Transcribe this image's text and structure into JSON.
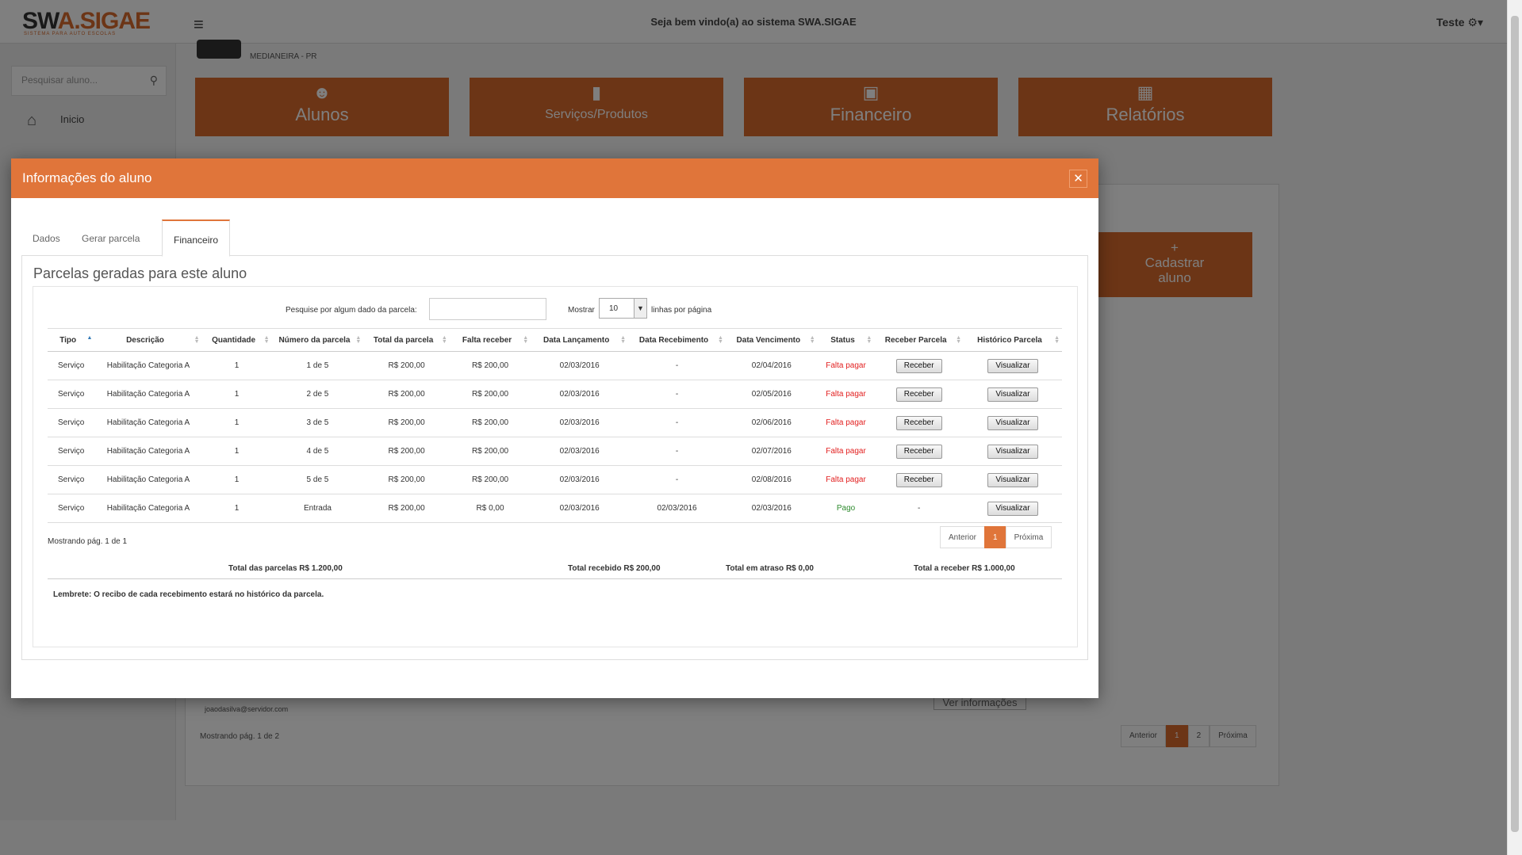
{
  "app": {
    "logo_part1": "SW",
    "logo_part2": "A.SIGAE",
    "logo_tagline": "SISTEMA PARA AUTO ESCOLAS",
    "welcome": "Seja bem vindo(a) ao sistema SWA.SIGAE",
    "user": "Teste",
    "city": "MEDIANEIRA - PR",
    "brand_color": "#d96a2c"
  },
  "sidebar": {
    "search_placeholder": "Pesquisar aluno...",
    "items": [
      {
        "label": "Inicio",
        "icon": "home-icon"
      }
    ]
  },
  "tiles": [
    {
      "label": "Alunos",
      "icon": "users-icon"
    },
    {
      "label": "Serviços/Produtos",
      "icon": "car-icon"
    },
    {
      "label": "Financeiro",
      "icon": "money-icon"
    },
    {
      "label": "Relatórios",
      "icon": "table-icon"
    }
  ],
  "background": {
    "add_student": "Cadastrar aluno",
    "email": "joaodasilva@servidor.com",
    "ver_info": "Ver informações",
    "showing": "Mostrando pág. 1 de 2",
    "pager": [
      "Anterior",
      "1",
      "2",
      "Próxima"
    ]
  },
  "modal": {
    "title": "Informações do aluno",
    "tabs": [
      "Dados",
      "Gerar parcela",
      "Financeiro"
    ],
    "active_tab": "Financeiro",
    "pane_title": "Parcelas geradas para este aluno",
    "filter_label": "Pesquise por algum dado da parcela:",
    "show_label": "Mostrar",
    "show_value": "10",
    "per_page": "linhas por página",
    "columns": [
      "Tipo",
      "Descrição",
      "Quantidade",
      "Número da parcela",
      "Total da parcela",
      "Falta receber",
      "Data Lançamento",
      "Data Recebimento",
      "Data Vencimento",
      "Status",
      "Receber Parcela",
      "Histórico Parcela"
    ],
    "rows": [
      {
        "tipo": "Serviço",
        "descricao": "Habilitação Categoria A",
        "qtd": "1",
        "numero": "1 de 5",
        "total": "R$ 200,00",
        "falta": "R$ 200,00",
        "lanc": "02/03/2016",
        "receb": "-",
        "venc": "02/04/2016",
        "status": "Falta pagar",
        "receber": "Receber",
        "hist": "Visualizar"
      },
      {
        "tipo": "Serviço",
        "descricao": "Habilitação Categoria A",
        "qtd": "1",
        "numero": "2 de 5",
        "total": "R$ 200,00",
        "falta": "R$ 200,00",
        "lanc": "02/03/2016",
        "receb": "-",
        "venc": "02/05/2016",
        "status": "Falta pagar",
        "receber": "Receber",
        "hist": "Visualizar"
      },
      {
        "tipo": "Serviço",
        "descricao": "Habilitação Categoria A",
        "qtd": "1",
        "numero": "3 de 5",
        "total": "R$ 200,00",
        "falta": "R$ 200,00",
        "lanc": "02/03/2016",
        "receb": "-",
        "venc": "02/06/2016",
        "status": "Falta pagar",
        "receber": "Receber",
        "hist": "Visualizar"
      },
      {
        "tipo": "Serviço",
        "descricao": "Habilitação Categoria A",
        "qtd": "1",
        "numero": "4 de 5",
        "total": "R$ 200,00",
        "falta": "R$ 200,00",
        "lanc": "02/03/2016",
        "receb": "-",
        "venc": "02/07/2016",
        "status": "Falta pagar",
        "receber": "Receber",
        "hist": "Visualizar"
      },
      {
        "tipo": "Serviço",
        "descricao": "Habilitação Categoria A",
        "qtd": "1",
        "numero": "5 de 5",
        "total": "R$ 200,00",
        "falta": "R$ 200,00",
        "lanc": "02/03/2016",
        "receb": "-",
        "venc": "02/08/2016",
        "status": "Falta pagar",
        "receber": "Receber",
        "hist": "Visualizar"
      },
      {
        "tipo": "Serviço",
        "descricao": "Habilitação Categoria A",
        "qtd": "1",
        "numero": "Entrada",
        "total": "R$ 200,00",
        "falta": "R$ 0,00",
        "lanc": "02/03/2016",
        "receb": "02/03/2016",
        "venc": "02/03/2016",
        "status": "Pago",
        "receber": "-",
        "hist": "Visualizar"
      }
    ],
    "showing": "Mostrando pág. 1 de 1",
    "pager": {
      "prev": "Anterior",
      "current": "1",
      "next": "Próxima"
    },
    "totals": {
      "parcelas": "Total das parcelas R$ 1.200,00",
      "recebido": "Total recebido R$ 200,00",
      "atraso": "Total em atraso R$ 0,00",
      "a_receber": "Total a receber R$ 1.000,00"
    },
    "reminder": "Lembrete: O recibo de cada recebimento estará no histórico da parcela.",
    "status_colors": {
      "Falta pagar": "#e21f1f",
      "Pago": "#2e8b2e"
    }
  }
}
